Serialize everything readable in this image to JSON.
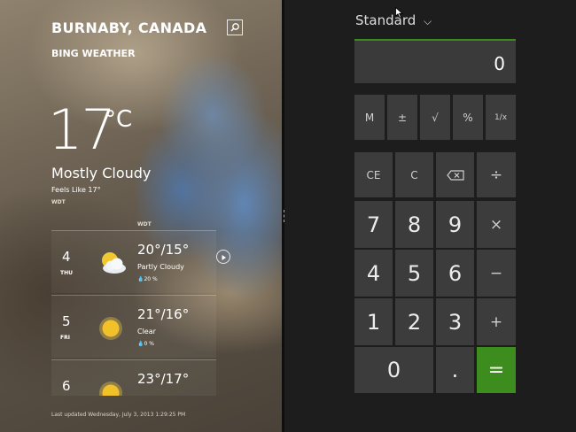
{
  "weather": {
    "city": "BURNABY, CANADA",
    "app_name": "BING WEATHER",
    "current_temp": "17",
    "unit": "°C",
    "condition": "Mostly Cloudy",
    "feels_like": "Feels Like 17°",
    "station": "WDT",
    "forecast_station": "WDT",
    "forecast": [
      {
        "day_num": "4",
        "day_name": "THU",
        "hilo": "20°/15°",
        "condition": "Partly Cloudy",
        "precip": "💧20 %",
        "icon": "partly-cloudy-icon"
      },
      {
        "day_num": "5",
        "day_name": "FRI",
        "hilo": "21°/16°",
        "condition": "Clear",
        "precip": "💧0 %",
        "icon": "sun-icon"
      },
      {
        "day_num": "6",
        "day_name": "",
        "hilo": "23°/17°",
        "condition": "",
        "precip": "",
        "icon": "sun-icon"
      }
    ],
    "last_updated": "Last updated Wednesday, July 3, 2013 1:29:25 PM"
  },
  "calculator": {
    "mode": "Standard",
    "mode_chevron": "⌵",
    "display": "0",
    "memory_row": [
      "M",
      "±",
      "√",
      "%",
      "1/x"
    ],
    "function_row": [
      "CE",
      "C",
      "⌫",
      "÷"
    ],
    "digits": {
      "d7": "7",
      "d8": "8",
      "d9": "9",
      "d4": "4",
      "d5": "5",
      "d6": "6",
      "d1": "1",
      "d2": "2",
      "d3": "3",
      "d0": "0",
      "dot": "."
    },
    "ops": {
      "multiply": "×",
      "minus": "−",
      "plus": "+",
      "equals": "="
    },
    "accent_color": "#3d8c1e"
  }
}
